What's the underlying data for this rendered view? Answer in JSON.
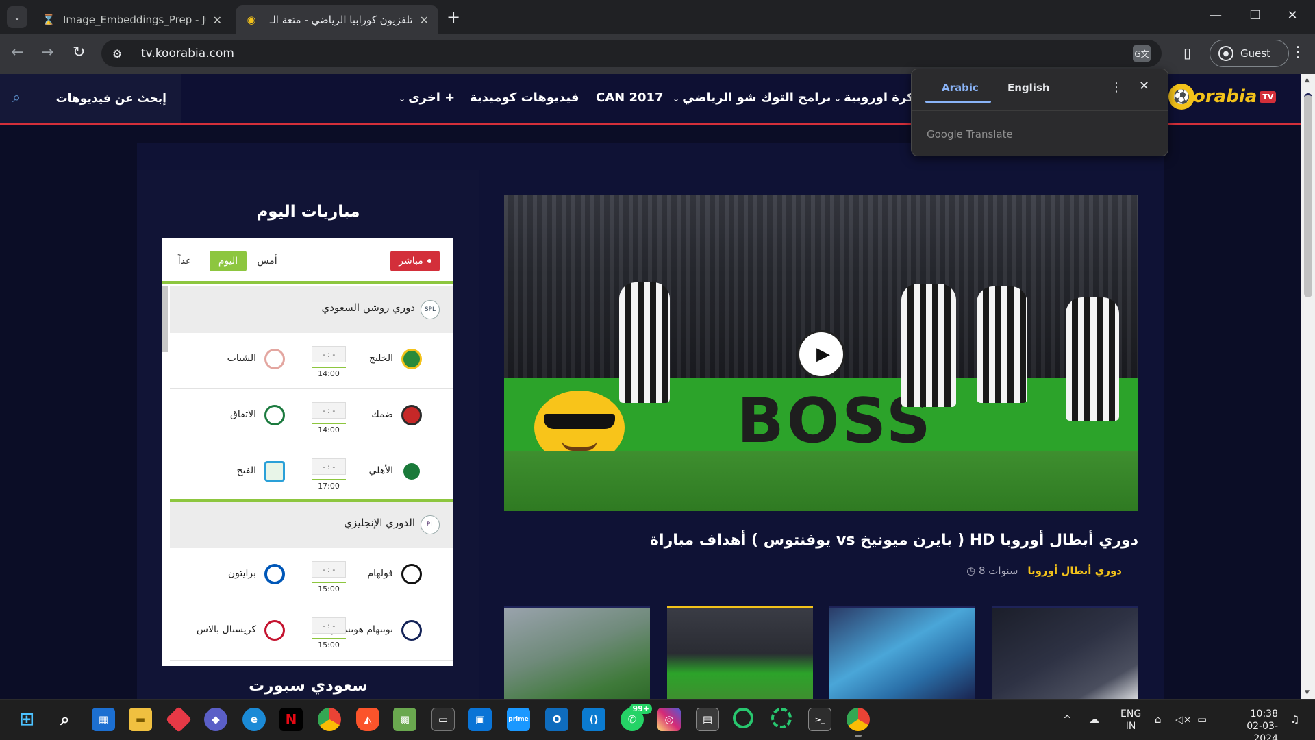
{
  "browser": {
    "tabs": [
      {
        "title": "Image_Embeddings_Prep - Jupy",
        "icon": "hourglass-icon"
      },
      {
        "title": "تلفزيون كورابيا الرياضي - متعة الـ",
        "icon": "koorabia-favicon"
      }
    ],
    "url": "tv.koorabia.com",
    "profile_label": "Guest"
  },
  "translate_popup": {
    "tab_source": "Arabic",
    "tab_target": "English",
    "brand": "Google Translate"
  },
  "site": {
    "logo_text": "orabia",
    "logo_tv": "TV",
    "search_placeholder": "إبحث عن فيديوهات",
    "nav": [
      {
        "label": "كرة اوروبية",
        "has_dropdown": true
      },
      {
        "label": "برامج التوك شو الرياضي",
        "has_dropdown": true
      },
      {
        "label": "CAN 2017",
        "has_dropdown": false
      },
      {
        "label": "فيديوهات كوميدية",
        "has_dropdown": false
      },
      {
        "label": "اخرى +",
        "has_dropdown": true
      }
    ],
    "accent_red": "#d32f3a",
    "accent_green": "#8dc63f",
    "accent_yellow": "#f3c21a"
  },
  "sidebar": {
    "title": "مباريات اليوم",
    "next_title": "سعودي سبورت",
    "tabs": {
      "live": "مباشر",
      "yesterday": "أمس",
      "today": "اليوم",
      "tomorrow": "غداً"
    },
    "leagues": [
      {
        "name": "دوري روشن السعودي",
        "logo_text": "SPL",
        "matches": [
          {
            "home": "الخليج",
            "away": "الشباب",
            "score": "- : -",
            "time": "14:00"
          },
          {
            "home": "ضمك",
            "away": "الاتفاق",
            "score": "- : -",
            "time": "14:00"
          },
          {
            "home": "الأهلي",
            "away": "الفتح",
            "score": "- : -",
            "time": "17:00"
          }
        ]
      },
      {
        "name": "الدوري الإنجليزي",
        "logo_text": "PL",
        "matches": [
          {
            "home": "فولهام",
            "away": "برايتون",
            "score": "- : -",
            "time": "15:00"
          },
          {
            "home": "توتنهام هوتسبير",
            "away": "كريستال بالاس",
            "score": "- : -",
            "time": "15:00"
          }
        ]
      }
    ]
  },
  "main_video": {
    "title": "أهداف مباراة ( يوفنتوس vs بايرن ميونيخ ) HD دوري أبطال أوروبا",
    "category": "دوري أبطال أوروبا",
    "age": "8 سنوات",
    "board_text": "BOSS"
  },
  "taskbar": {
    "apps": [
      "start",
      "search",
      "store",
      "file-explorer",
      "app-red",
      "app-copilot",
      "edge",
      "netflix",
      "chrome",
      "brave",
      "minecraft",
      "terminal",
      "app-blue",
      "prime-video",
      "outlook",
      "vscode",
      "whatsapp",
      "instagram",
      "app-gray",
      "app-green-ring",
      "app-green-ring-2",
      "cmd",
      "chrome-active"
    ],
    "whatsapp_badge": "99+",
    "lang_line1": "ENG",
    "lang_line2": "IN",
    "time": "10:38",
    "date": "02-03-2024"
  }
}
